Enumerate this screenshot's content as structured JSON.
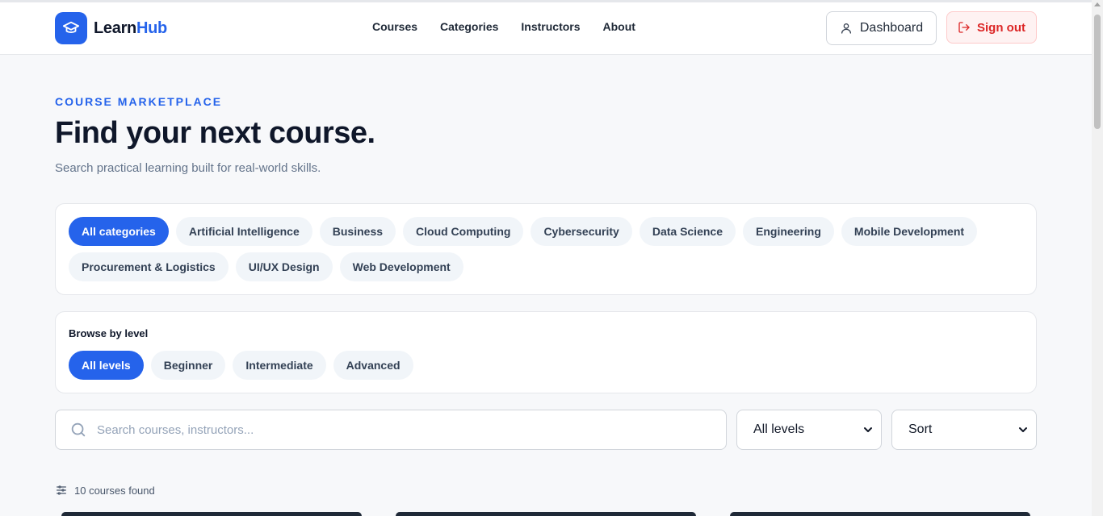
{
  "brand": {
    "name_part1": "Learn",
    "name_part2": "Hub",
    "logo_icon": "graduation-cap-icon",
    "accent": "#2563eb"
  },
  "nav": {
    "items": [
      "Courses",
      "Categories",
      "Instructors",
      "About"
    ]
  },
  "header_actions": {
    "dashboard_label": "Dashboard",
    "dashboard_icon": "user-icon",
    "signout_label": "Sign out",
    "signout_icon": "sign-out-icon",
    "signout_color": "#dc2626"
  },
  "hero": {
    "eyebrow": "COURSE MARKETPLACE",
    "title": "Find your next course.",
    "subtitle": "Search practical learning built for real-world skills."
  },
  "categories": {
    "row1": [
      "All categories",
      "Artificial Intelligence",
      "Business",
      "Cloud Computing",
      "Cybersecurity",
      "Data Science",
      "Engineering",
      "Mobile Development"
    ],
    "row2": [
      "Procurement & Logistics",
      "UI/UX Design",
      "Web Development"
    ],
    "active": "All categories"
  },
  "level": {
    "title": "Browse by level",
    "options": [
      "All levels",
      "Beginner",
      "Intermediate",
      "Advanced"
    ],
    "active": "All levels"
  },
  "search": {
    "placeholder": "Search courses, instructors...",
    "value": ""
  },
  "filters": {
    "level_select": "All levels",
    "sort_select": "Sort"
  },
  "results": {
    "count_text": "10 courses found",
    "icon": "sliders-icon"
  }
}
